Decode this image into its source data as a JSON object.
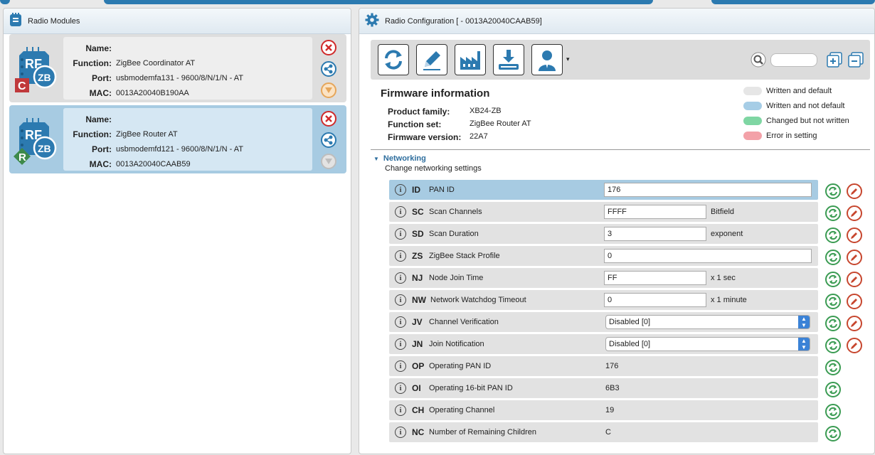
{
  "left": {
    "title": "Radio Modules",
    "modules": [
      {
        "badge": "C",
        "logo_rf": "RF",
        "logo_zb": "ZB",
        "name_label": "Name:",
        "name": "",
        "function_label": "Function:",
        "function": "ZigBee Coordinator AT",
        "port_label": "Port:",
        "port": "usbmodemfa131 - 9600/8/N/1/N - AT",
        "mac_label": "MAC:",
        "mac": "0013A20040B190AA"
      },
      {
        "badge": "R",
        "logo_rf": "RF",
        "logo_zb": "ZB",
        "name_label": "Name:",
        "name": "",
        "function_label": "Function:",
        "function": "ZigBee Router AT",
        "port_label": "Port:",
        "port": "usbmodemfd121 - 9600/8/N/1/N - AT",
        "mac_label": "MAC:",
        "mac": "0013A20040CAAB59"
      }
    ]
  },
  "right": {
    "title": "Radio Configuration [  - 0013A20040CAAB59]",
    "search_value": "",
    "firmware": {
      "title": "Firmware information",
      "product_family_label": "Product family:",
      "product_family": "XB24-ZB",
      "function_set_label": "Function set:",
      "function_set": "ZigBee Router AT",
      "firmware_version_label": "Firmware version:",
      "firmware_version": "22A7"
    },
    "legend": [
      {
        "label": "Written and default",
        "color": "#e6e6e6"
      },
      {
        "label": "Written and not default",
        "color": "#a6cde6"
      },
      {
        "label": "Changed but not written",
        "color": "#7fd6a3"
      },
      {
        "label": "Error in setting",
        "color": "#f3a1a8"
      }
    ],
    "section": {
      "title": "Networking",
      "description": "Change networking settings"
    },
    "params": [
      {
        "code": "ID",
        "name": "PAN ID",
        "value": "176",
        "kind": "wide",
        "unit": ""
      },
      {
        "code": "SC",
        "name": "Scan Channels",
        "value": "FFFF",
        "kind": "short",
        "unit": "Bitfield"
      },
      {
        "code": "SD",
        "name": "Scan Duration",
        "value": "3",
        "kind": "short",
        "unit": "exponent"
      },
      {
        "code": "ZS",
        "name": "ZigBee Stack Profile",
        "value": "0",
        "kind": "wide",
        "unit": ""
      },
      {
        "code": "NJ",
        "name": "Node Join Time",
        "value": "FF",
        "kind": "short",
        "unit": "x 1 sec"
      },
      {
        "code": "NW",
        "name": "Network Watchdog Timeout",
        "value": "0",
        "kind": "short",
        "unit": "x 1 minute"
      },
      {
        "code": "JV",
        "name": "Channel Verification",
        "value": "Disabled [0]",
        "kind": "select",
        "unit": ""
      },
      {
        "code": "JN",
        "name": "Join Notification",
        "value": "Disabled [0]",
        "kind": "select",
        "unit": ""
      },
      {
        "code": "OP",
        "name": "Operating PAN ID",
        "value": "176",
        "kind": "ro",
        "unit": ""
      },
      {
        "code": "OI",
        "name": "Operating 16-bit PAN ID",
        "value": "6B3",
        "kind": "ro",
        "unit": ""
      },
      {
        "code": "CH",
        "name": "Operating Channel",
        "value": "19",
        "kind": "ro",
        "unit": ""
      },
      {
        "code": "NC",
        "name": "Number of Remaining Children",
        "value": "C",
        "kind": "ro",
        "unit": ""
      }
    ]
  }
}
